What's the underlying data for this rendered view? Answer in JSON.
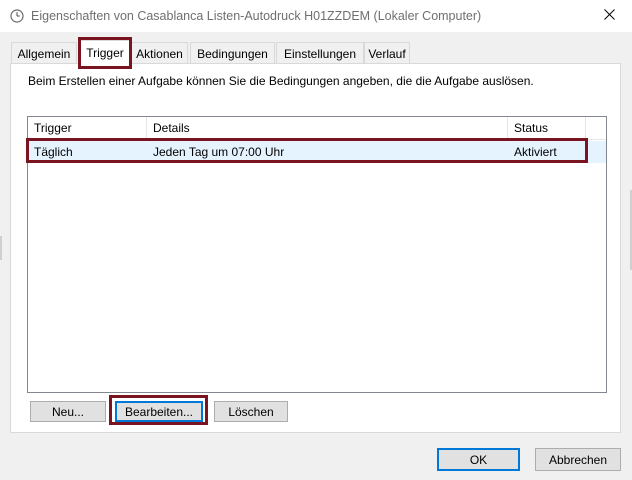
{
  "window": {
    "title": "Eigenschaften von Casablanca Listen-Autodruck H01ZZDEM (Lokaler Computer)",
    "icon": "clock-icon",
    "close_icon": "close-icon"
  },
  "tabs": [
    {
      "label": "Allgemein"
    },
    {
      "label": "Trigger",
      "active": true
    },
    {
      "label": "Aktionen"
    },
    {
      "label": "Bedingungen"
    },
    {
      "label": "Einstellungen"
    },
    {
      "label": "Verlauf"
    }
  ],
  "panel": {
    "description": "Beim Erstellen einer Aufgabe können Sie die Bedingungen angeben, die die Aufgabe auslösen."
  },
  "list": {
    "columns": [
      "Trigger",
      "Details",
      "Status"
    ],
    "rows": [
      [
        "Täglich",
        "Jeden Tag um 07:00 Uhr",
        "Aktiviert"
      ]
    ]
  },
  "actions": {
    "new": "Neu...",
    "edit": "Bearbeiten...",
    "delete": "Löschen"
  },
  "footer": {
    "ok": "OK",
    "cancel": "Abbrechen"
  },
  "colors": {
    "highlight": "#7a1421",
    "selection": "#e5f3ff",
    "focus_border": "#0078d7"
  }
}
